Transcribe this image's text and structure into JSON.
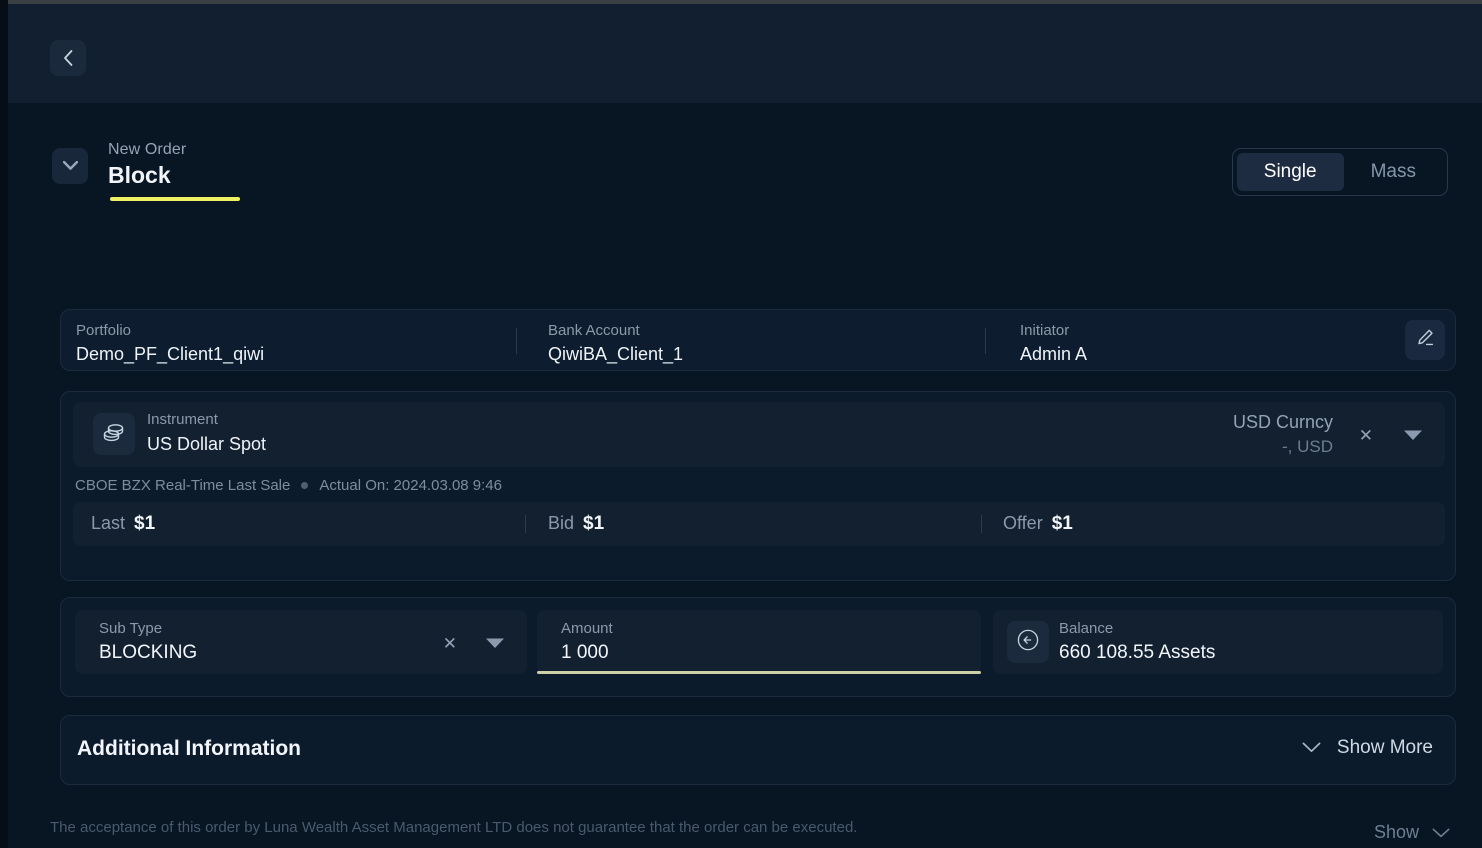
{
  "window": {
    "back_icon": "chevron-left-icon"
  },
  "order": {
    "kicker": "New Order",
    "title": "Block",
    "caret_icon": "chevron-down-icon",
    "accent_color": "#eff062",
    "mode_tabs": [
      {
        "label": "Single",
        "active": true
      },
      {
        "label": "Mass",
        "active": false
      }
    ]
  },
  "info": {
    "edit_icon": "pencil-icon",
    "fields": [
      {
        "label": "Portfolio",
        "value": "Demo_PF_Client1_qiwi"
      },
      {
        "label": "Bank Account",
        "value": "QiwiBA_Client_1"
      },
      {
        "label": "Initiator",
        "value": "Admin A"
      }
    ]
  },
  "instrument": {
    "icon": "coins-stack-icon",
    "label": "Instrument",
    "value": "US Dollar Spot",
    "currency": {
      "name": "USD Curncy",
      "detail": "-, USD",
      "clear_icon": "close-icon",
      "caret_icon": "caret-down-icon"
    },
    "source": "CBOE BZX Real-Time Last Sale",
    "actual_on": "Actual On: 2024.03.08 9:46",
    "quotes": [
      {
        "label": "Last",
        "value": "$1"
      },
      {
        "label": "Bid",
        "value": "$1"
      },
      {
        "label": "Offer",
        "value": "$1"
      }
    ]
  },
  "fields": {
    "sub_type": {
      "label": "Sub Type",
      "value": "BLOCKING",
      "clear_icon": "close-icon",
      "caret_icon": "caret-down-icon"
    },
    "amount": {
      "label": "Amount",
      "value": "1 000",
      "placeholder": "Amount",
      "focused": true,
      "focus_color": "#ccd0a8"
    },
    "balance": {
      "icon": "circle-arrow-left-icon",
      "label": "Balance",
      "value": "660 108.55 Assets"
    }
  },
  "additional": {
    "title": "Additional Information",
    "toggle_label": "Show More",
    "toggle_icon": "chevron-down-icon"
  },
  "footer": {
    "disclaimer": "The acceptance of this order by Luna Wealth Asset Management LTD does not guarantee that the order can be executed.",
    "show_label": "Show",
    "show_icon": "chevron-down-icon"
  }
}
